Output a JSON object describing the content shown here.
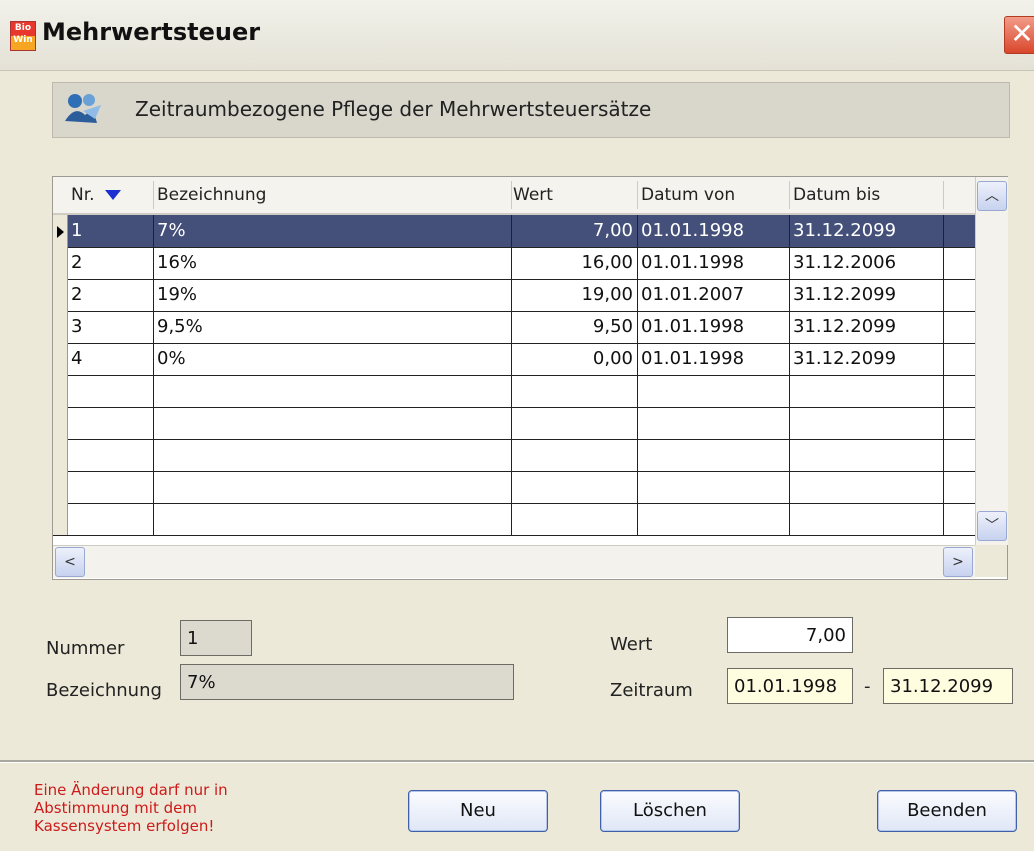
{
  "window": {
    "app_icon_text": "Bio Win",
    "title": "Mehrwertsteuer",
    "close_glyph": "✕"
  },
  "header": {
    "text": "Zeitraumbezogene Pflege der Mehrwertsteuersätze",
    "icon": "people-arrow-icon"
  },
  "grid": {
    "columns": [
      "Nr.",
      "Bezeichnung",
      "Wert",
      "Datum von",
      "Datum bis"
    ],
    "rows": [
      {
        "nr": "1",
        "bezeichnung": "7%",
        "wert": "7,00",
        "von": "01.01.1998",
        "bis": "31.12.2099",
        "selected": true
      },
      {
        "nr": "2",
        "bezeichnung": "16%",
        "wert": "16,00",
        "von": "01.01.1998",
        "bis": "31.12.2006",
        "selected": false
      },
      {
        "nr": "2",
        "bezeichnung": "19%",
        "wert": "19,00",
        "von": "01.01.2007",
        "bis": "31.12.2099",
        "selected": false
      },
      {
        "nr": "3",
        "bezeichnung": "9,5%",
        "wert": "9,50",
        "von": "01.01.1998",
        "bis": "31.12.2099",
        "selected": false
      },
      {
        "nr": "4",
        "bezeichnung": "0%",
        "wert": "0,00",
        "von": "01.01.1998",
        "bis": "31.12.2099",
        "selected": false
      }
    ],
    "scroll_up": "︿",
    "scroll_down": "﹀",
    "scroll_left": "<",
    "scroll_right": ">"
  },
  "form": {
    "nummer_label": "Nummer",
    "nummer_value": "1",
    "bezeichnung_label": "Bezeichnung",
    "bezeichnung_value": "7%",
    "wert_label": "Wert",
    "wert_value": "7,00",
    "zeitraum_label": "Zeitraum",
    "zeitraum_from": "01.01.1998",
    "zeitraum_sep": "-",
    "zeitraum_to": "31.12.2099"
  },
  "footer": {
    "warning": "Eine Änderung darf nur in Abstimmung mit dem Kassensystem erfolgen!",
    "buttons": {
      "neu": "Neu",
      "loeschen": "Löschen",
      "beenden": "Beenden"
    }
  },
  "colors": {
    "selection": "#44507a",
    "warning": "#cc1b1b",
    "sort_arrow": "#1c2fd1"
  }
}
